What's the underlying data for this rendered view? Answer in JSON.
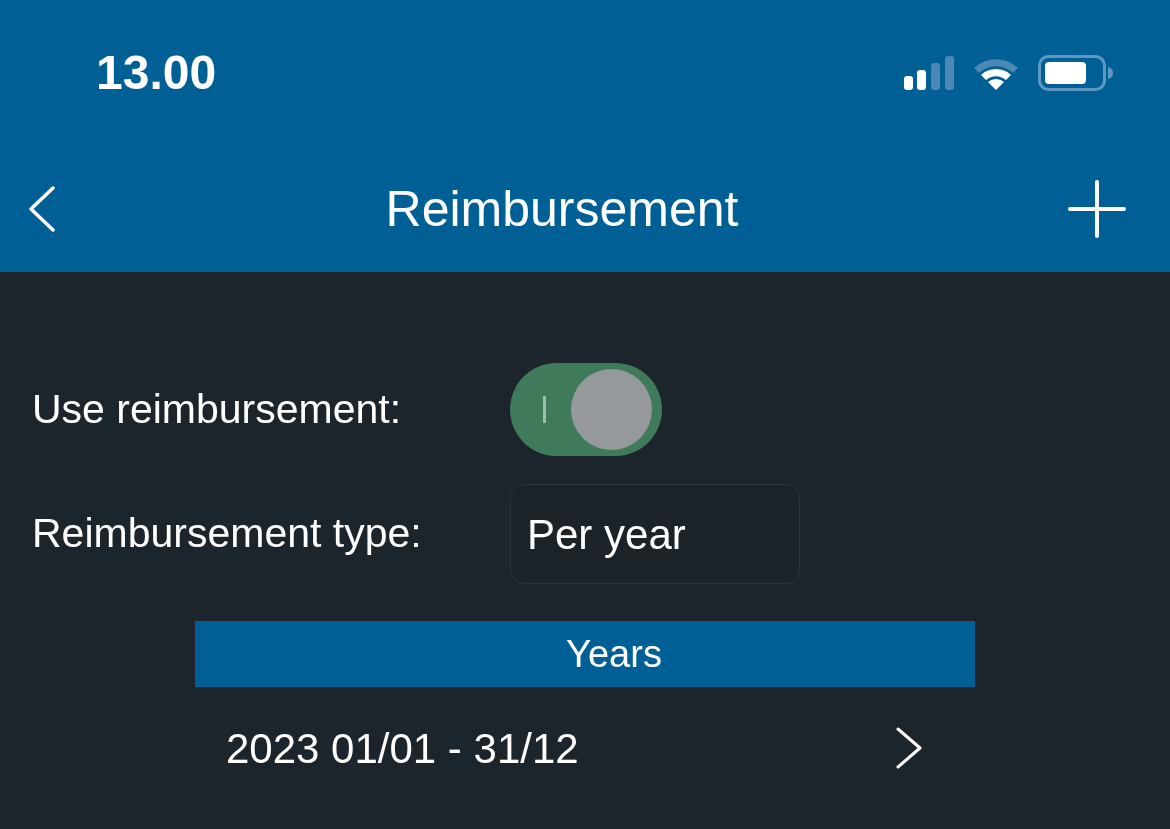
{
  "status_bar": {
    "time": "13.00"
  },
  "nav_bar": {
    "title": "Reimbursement"
  },
  "settings": [
    {
      "kind": "toggle",
      "label": "Use reimbursement:",
      "on": true
    },
    {
      "kind": "select",
      "label": "Reimbursement type:",
      "value": "Per year"
    }
  ],
  "years": {
    "header": "Years",
    "rows": [
      {
        "label": "2023 01/01 - 31/12"
      }
    ]
  }
}
